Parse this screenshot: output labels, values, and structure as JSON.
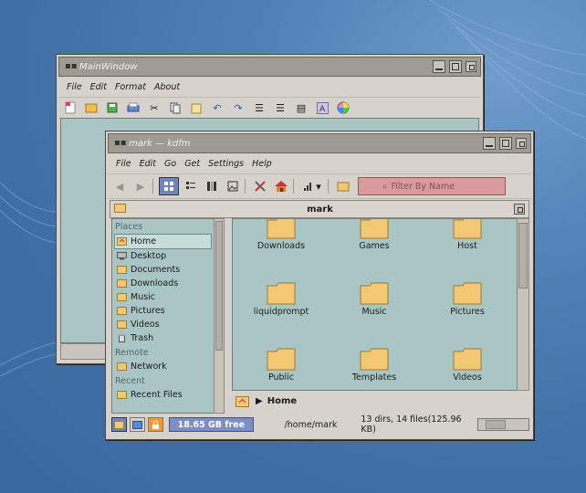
{
  "main_window": {
    "title": "MainWindow",
    "menu": [
      "File",
      "Edit",
      "Format",
      "About"
    ]
  },
  "kdfm": {
    "title": "mark — kdfm",
    "menu": [
      "File",
      "Edit",
      "Go",
      "Get",
      "Settings",
      "Help"
    ],
    "filter_placeholder": "Filter By Name",
    "path_title": "mark",
    "places_header": "Places",
    "places": [
      "Home",
      "Desktop",
      "Documents",
      "Downloads",
      "Music",
      "Pictures",
      "Videos",
      "Trash"
    ],
    "remote_header": "Remote",
    "remote": [
      "Network"
    ],
    "recent_header": "Recent",
    "recent": [
      "Recent Files"
    ],
    "folders": [
      "Downloads",
      "Games",
      "Host",
      "liquidprompt",
      "Music",
      "Pictures",
      "Public",
      "Templates",
      "Videos"
    ],
    "location": "Home",
    "free_space": "18.65 GB free",
    "status_path": "/home/mark",
    "status_counts": "13 dirs, 14 files(125.96 KB)"
  },
  "colors": {
    "folder": "#f2c873",
    "selection": "#c7ddd9",
    "desktop": "#4a7ab0"
  }
}
